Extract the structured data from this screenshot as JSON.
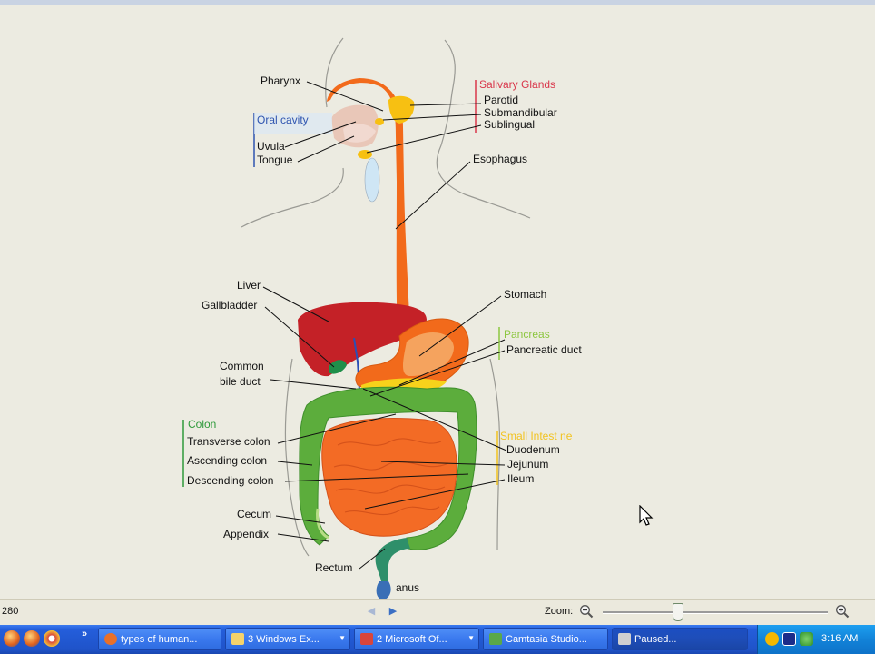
{
  "diagram": {
    "labels": {
      "pharynx": "Pharynx",
      "salivary_glands": "Salivary Glands",
      "parotid": "Parotid",
      "submandibular": "Submandibular",
      "sublingual": "Sublingual",
      "oral_cavity": "Oral cavity",
      "uvula": "Uvula",
      "tongue": "Tongue",
      "esophagus": "Esophagus",
      "liver": "Liver",
      "gallbladder": "Gallbladder",
      "stomach": "Stomach",
      "pancreas": "Pancreas",
      "pancreatic_duct": "Pancreatic duct",
      "common_bile_duct_1": "Common",
      "common_bile_duct_2": "bile duct",
      "colon": "Colon",
      "transverse_colon": "Transverse colon",
      "ascending_colon": "Ascending colon",
      "descending_colon": "Descending colon",
      "small_intestine": "Small Intest ne",
      "duodenum": "Duodenum",
      "jejunum": "Jejunum",
      "ileum": "Ileum",
      "cecum": "Cecum",
      "appendix": "Appendix",
      "rectum": "Rectum",
      "anus": "anus"
    },
    "colors": {
      "salivary": "#d9364a",
      "oral": "#2f55b0",
      "pancreas": "#8cc63f",
      "colon": "#2e9a3a",
      "small_intestine": "#f2c320",
      "esophagus": "#f26a1b",
      "liver": "#c42127",
      "colon_fill": "#5cad3c",
      "intestine_fill": "#f36b25"
    }
  },
  "statusbar": {
    "page_number": "280",
    "zoom_label": "Zoom:",
    "zoom_level": 0.33
  },
  "taskbar": {
    "quicklaunch_more": "»",
    "buttons": [
      {
        "label": "types of human...",
        "icon": "firefox-icon",
        "color": "#e8702a"
      },
      {
        "label": "3 Windows Ex...",
        "icon": "folder-icon",
        "color": "#f5d36b"
      },
      {
        "label": "2 Microsoft Of...",
        "icon": "office-icon",
        "color": "#d8453b"
      },
      {
        "label": "Camtasia Studio...",
        "icon": "camtasia-icon",
        "color": "#5aa84a"
      },
      {
        "label": "Paused...",
        "icon": "recorder-icon",
        "color": "#d0d0d0"
      }
    ],
    "clock": "3:16 AM"
  }
}
